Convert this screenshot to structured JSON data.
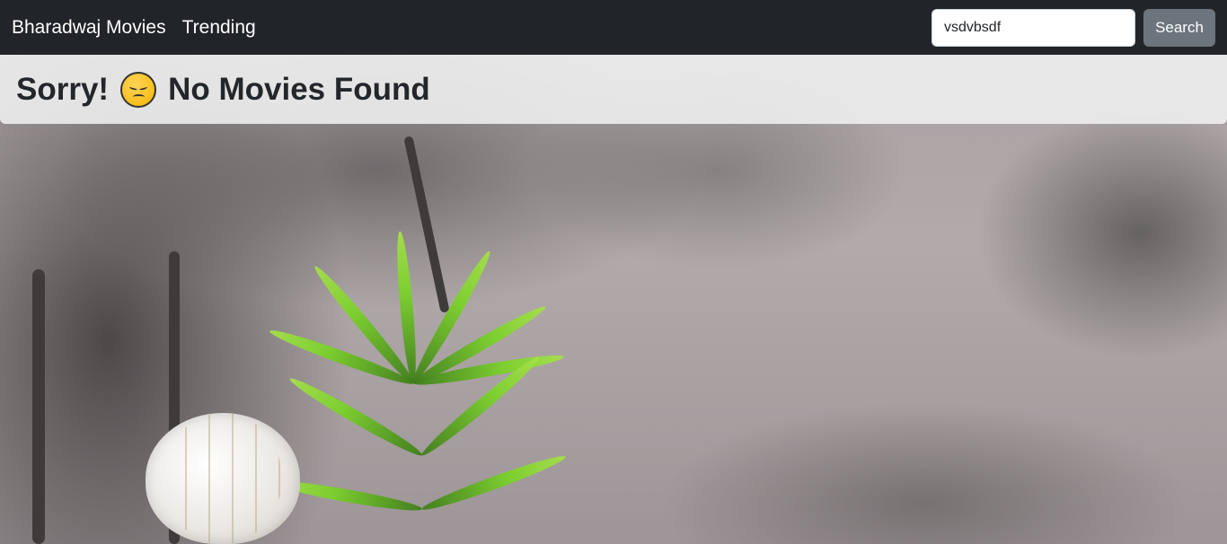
{
  "navbar": {
    "brand": "Bharadwaj Movies",
    "links": [
      "Trending"
    ],
    "search": {
      "value": "vsdvbsdf",
      "button_label": "Search"
    }
  },
  "message": {
    "prefix": "Sorry!",
    "emoji_icon": "sad-face-icon",
    "suffix": "No Movies Found"
  },
  "colors": {
    "navbar_bg": "#212529",
    "search_button_bg": "#6c757d"
  }
}
